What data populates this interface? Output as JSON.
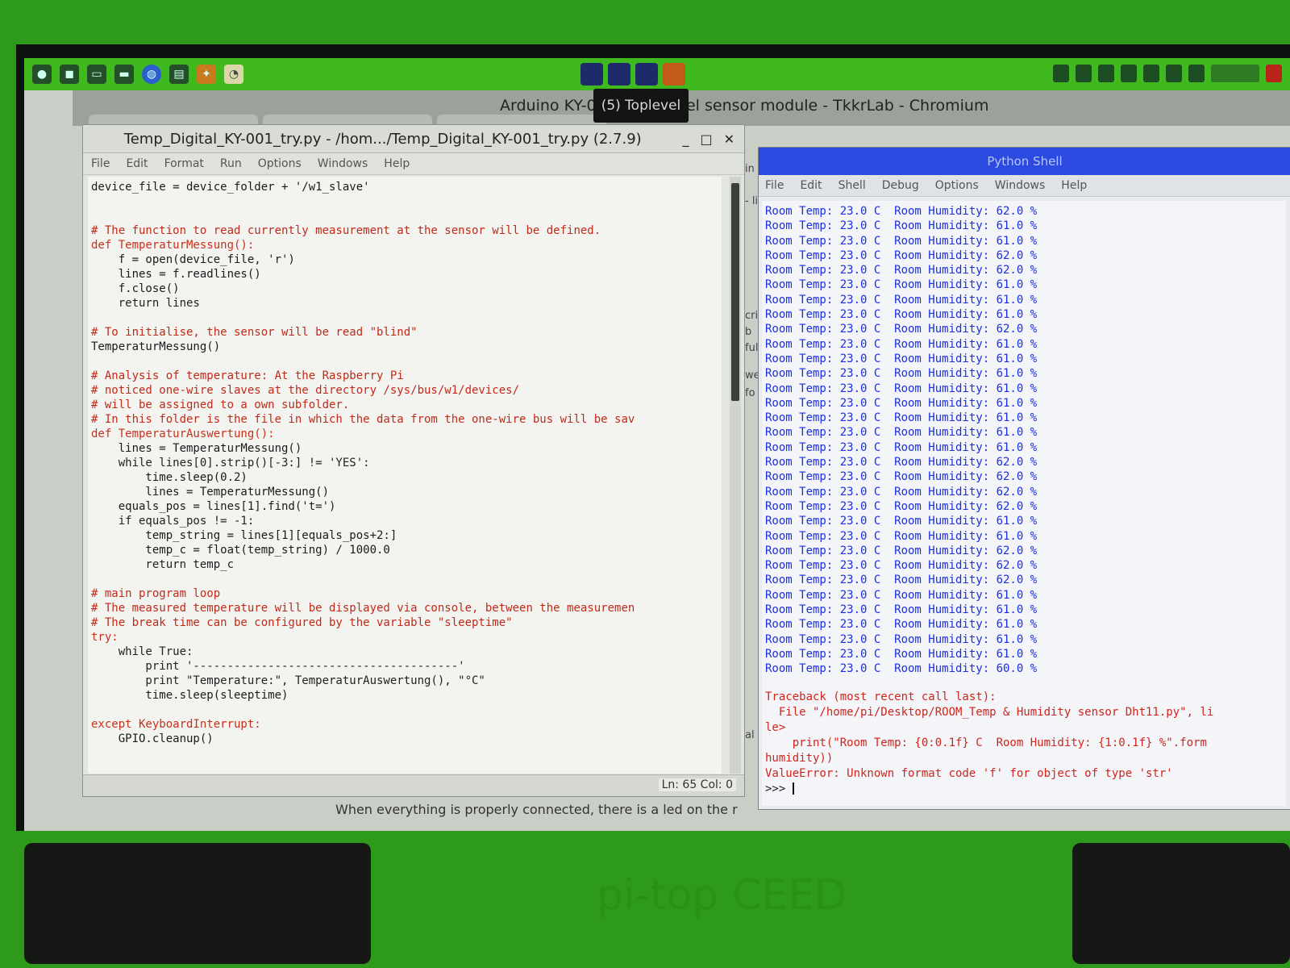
{
  "taskbar": {
    "icons": [
      "raspberry-icon",
      "browser-icon",
      "terminal-icon",
      "folder-icon",
      "globe-icon",
      "document-icon",
      "python-icon",
      "audio-icon"
    ]
  },
  "browser": {
    "title": "Arduino KY-00 (5) Toplevel sensor module - TkkrLab - Chromium",
    "tooltip": "(5) Toplevel",
    "footer_text": "When everything is properly connected, there is a led on the r"
  },
  "editor": {
    "title": "Temp_Digital_KY-001_try.py - /hom.../Temp_Digital_KY-001_try.py (2.7.9)",
    "menu": [
      "File",
      "Edit",
      "Format",
      "Run",
      "Options",
      "Windows",
      "Help"
    ],
    "status": "Ln: 65 Col: 0",
    "code": [
      "device_file = device_folder + '/w1_slave'",
      "",
      "",
      "# The function to read currently measurement at the sensor will be defined.",
      "def TemperaturMessung():",
      "    f = open(device_file, 'r')",
      "    lines = f.readlines()",
      "    f.close()",
      "    return lines",
      "",
      "# To initialise, the sensor will be read \"blind\"",
      "TemperaturMessung()",
      "",
      "# Analysis of temperature: At the Raspberry Pi",
      "# noticed one-wire slaves at the directory /sys/bus/w1/devices/",
      "# will be assigned to a own subfolder.",
      "# In this folder is the file in which the data from the one-wire bus will be sav",
      "def TemperaturAuswertung():",
      "    lines = TemperaturMessung()",
      "    while lines[0].strip()[-3:] != 'YES':",
      "        time.sleep(0.2)",
      "        lines = TemperaturMessung()",
      "    equals_pos = lines[1].find('t=')",
      "    if equals_pos != -1:",
      "        temp_string = lines[1][equals_pos+2:]",
      "        temp_c = float(temp_string) / 1000.0",
      "        return temp_c",
      "",
      "# main program loop",
      "# The measured temperature will be displayed via console, between the measuremen",
      "# The break time can be configured by the variable \"sleeptime\"",
      "try:",
      "    while True:",
      "        print '---------------------------------------'",
      "        print \"Temperature:\", TemperaturAuswertung(), \"°C\"",
      "        time.sleep(sleeptime)",
      "",
      "except KeyboardInterrupt:",
      "    GPIO.cleanup()"
    ]
  },
  "shell": {
    "title": "Python Shell",
    "menu": [
      "File",
      "Edit",
      "Shell",
      "Debug",
      "Options",
      "Windows",
      "Help"
    ],
    "readings": [
      "Room Temp: 23.0 C  Room Humidity: 62.0 %",
      "Room Temp: 23.0 C  Room Humidity: 61.0 %",
      "Room Temp: 23.0 C  Room Humidity: 61.0 %",
      "Room Temp: 23.0 C  Room Humidity: 62.0 %",
      "Room Temp: 23.0 C  Room Humidity: 62.0 %",
      "Room Temp: 23.0 C  Room Humidity: 61.0 %",
      "Room Temp: 23.0 C  Room Humidity: 61.0 %",
      "Room Temp: 23.0 C  Room Humidity: 61.0 %",
      "Room Temp: 23.0 C  Room Humidity: 62.0 %",
      "Room Temp: 23.0 C  Room Humidity: 61.0 %",
      "Room Temp: 23.0 C  Room Humidity: 61.0 %",
      "Room Temp: 23.0 C  Room Humidity: 61.0 %",
      "Room Temp: 23.0 C  Room Humidity: 61.0 %",
      "Room Temp: 23.0 C  Room Humidity: 61.0 %",
      "Room Temp: 23.0 C  Room Humidity: 61.0 %",
      "Room Temp: 23.0 C  Room Humidity: 61.0 %",
      "Room Temp: 23.0 C  Room Humidity: 61.0 %",
      "Room Temp: 23.0 C  Room Humidity: 62.0 %",
      "Room Temp: 23.0 C  Room Humidity: 62.0 %",
      "Room Temp: 23.0 C  Room Humidity: 62.0 %",
      "Room Temp: 23.0 C  Room Humidity: 62.0 %",
      "Room Temp: 23.0 C  Room Humidity: 61.0 %",
      "Room Temp: 23.0 C  Room Humidity: 61.0 %",
      "Room Temp: 23.0 C  Room Humidity: 62.0 %",
      "Room Temp: 23.0 C  Room Humidity: 62.0 %",
      "Room Temp: 23.0 C  Room Humidity: 62.0 %",
      "Room Temp: 23.0 C  Room Humidity: 61.0 %",
      "Room Temp: 23.0 C  Room Humidity: 61.0 %",
      "Room Temp: 23.0 C  Room Humidity: 61.0 %",
      "Room Temp: 23.0 C  Room Humidity: 61.0 %",
      "Room Temp: 23.0 C  Room Humidity: 61.0 %",
      "Room Temp: 23.0 C  Room Humidity: 60.0 %"
    ],
    "traceback": [
      "Traceback (most recent call last):",
      "  File \"/home/pi/Desktop/ROOM_Temp & Humidity sensor Dht11.py\", li",
      "le>",
      "    print(\"Room Temp: {0:0.1f} C  Room Humidity: {1:0.1f} %\".form",
      "humidity))",
      "ValueError: Unknown format code 'f' for object of type 'str'"
    ],
    "prompt": ">>> "
  },
  "side_fragments": [
    "in",
    "- li",
    "cri",
    "b",
    "ful",
    "we",
    "fo",
    "al"
  ],
  "brand": "pi-top CEED"
}
